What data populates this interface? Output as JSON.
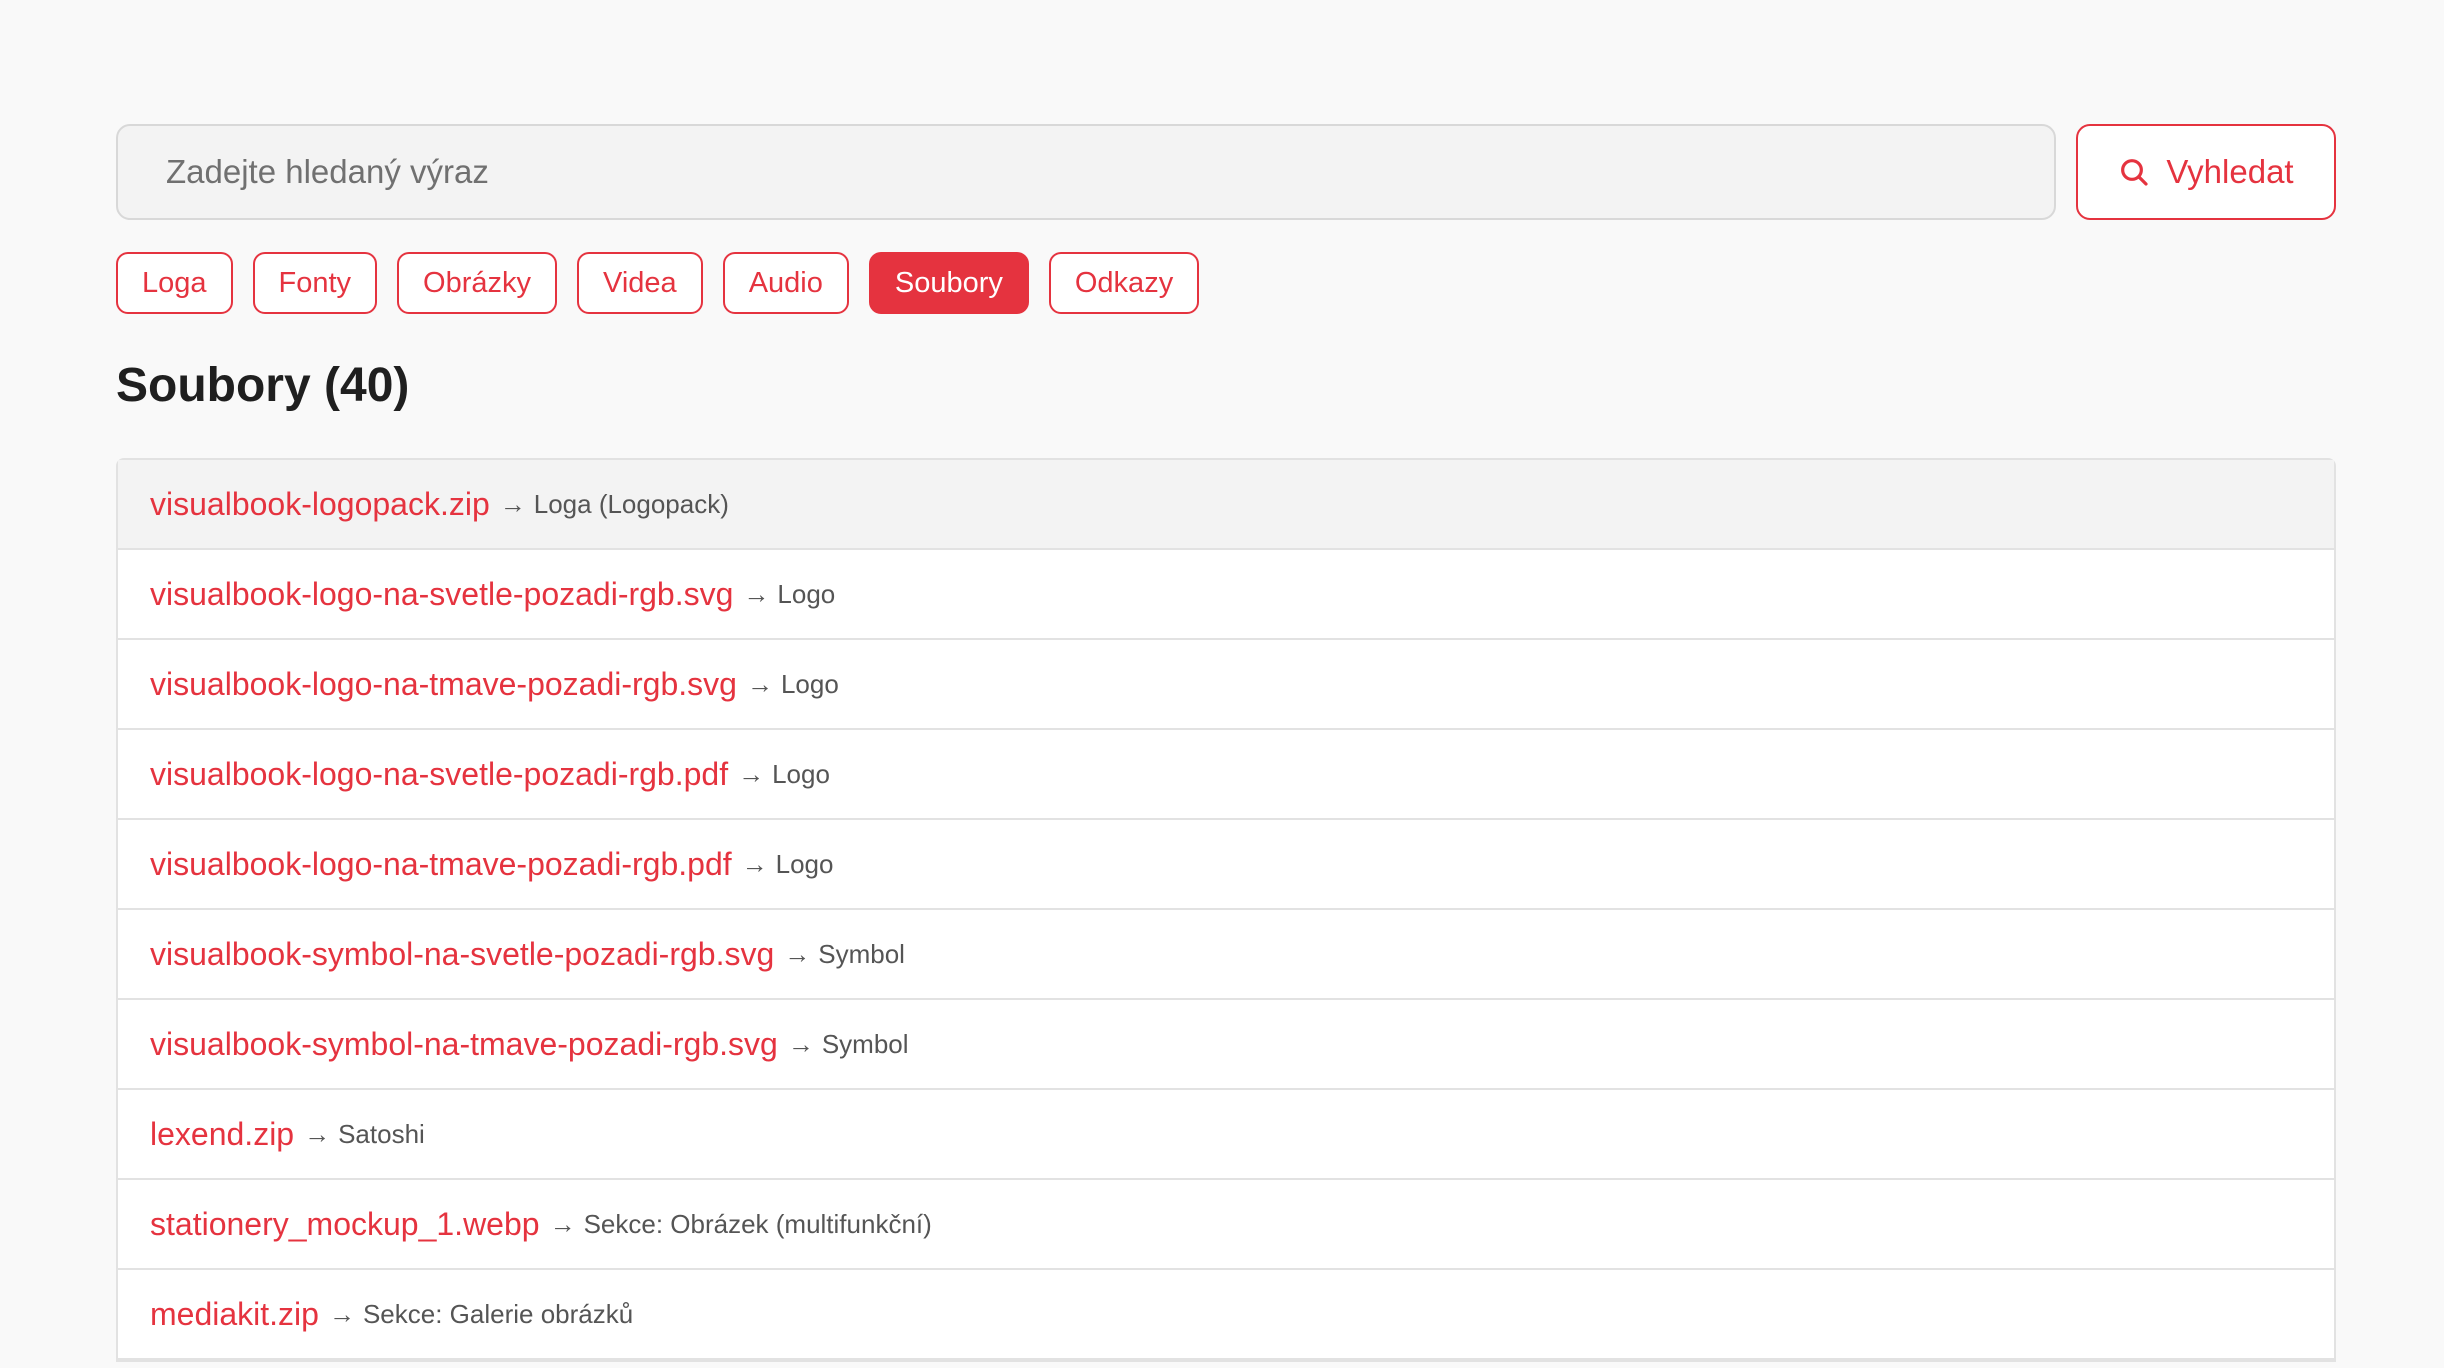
{
  "search": {
    "placeholder": "Zadejte hledaný výraz",
    "value": "",
    "button_label": "Vyhledat"
  },
  "colors": {
    "accent": "#e5333f",
    "background": "#f9f9f9"
  },
  "tabs": [
    {
      "label": "Loga",
      "active": false
    },
    {
      "label": "Fonty",
      "active": false
    },
    {
      "label": "Obrázky",
      "active": false
    },
    {
      "label": "Videa",
      "active": false
    },
    {
      "label": "Audio",
      "active": false
    },
    {
      "label": "Soubory",
      "active": true
    },
    {
      "label": "Odkazy",
      "active": false
    }
  ],
  "section": {
    "title": "Soubory (40)"
  },
  "arrow_glyph": "→",
  "files": [
    {
      "name": "visualbook-logopack.zip",
      "target": "Loga (Logopack)"
    },
    {
      "name": "visualbook-logo-na-svetle-pozadi-rgb.svg",
      "target": "Logo"
    },
    {
      "name": "visualbook-logo-na-tmave-pozadi-rgb.svg",
      "target": "Logo"
    },
    {
      "name": "visualbook-logo-na-svetle-pozadi-rgb.pdf",
      "target": "Logo"
    },
    {
      "name": "visualbook-logo-na-tmave-pozadi-rgb.pdf",
      "target": "Logo"
    },
    {
      "name": "visualbook-symbol-na-svetle-pozadi-rgb.svg",
      "target": "Symbol"
    },
    {
      "name": "visualbook-symbol-na-tmave-pozadi-rgb.svg",
      "target": "Symbol"
    },
    {
      "name": "lexend.zip",
      "target": "Satoshi"
    },
    {
      "name": "stationery_mockup_1.webp",
      "target": "Sekce: Obrázek (multifunkční)"
    },
    {
      "name": "mediakit.zip",
      "target": "Sekce: Galerie obrázků"
    }
  ]
}
